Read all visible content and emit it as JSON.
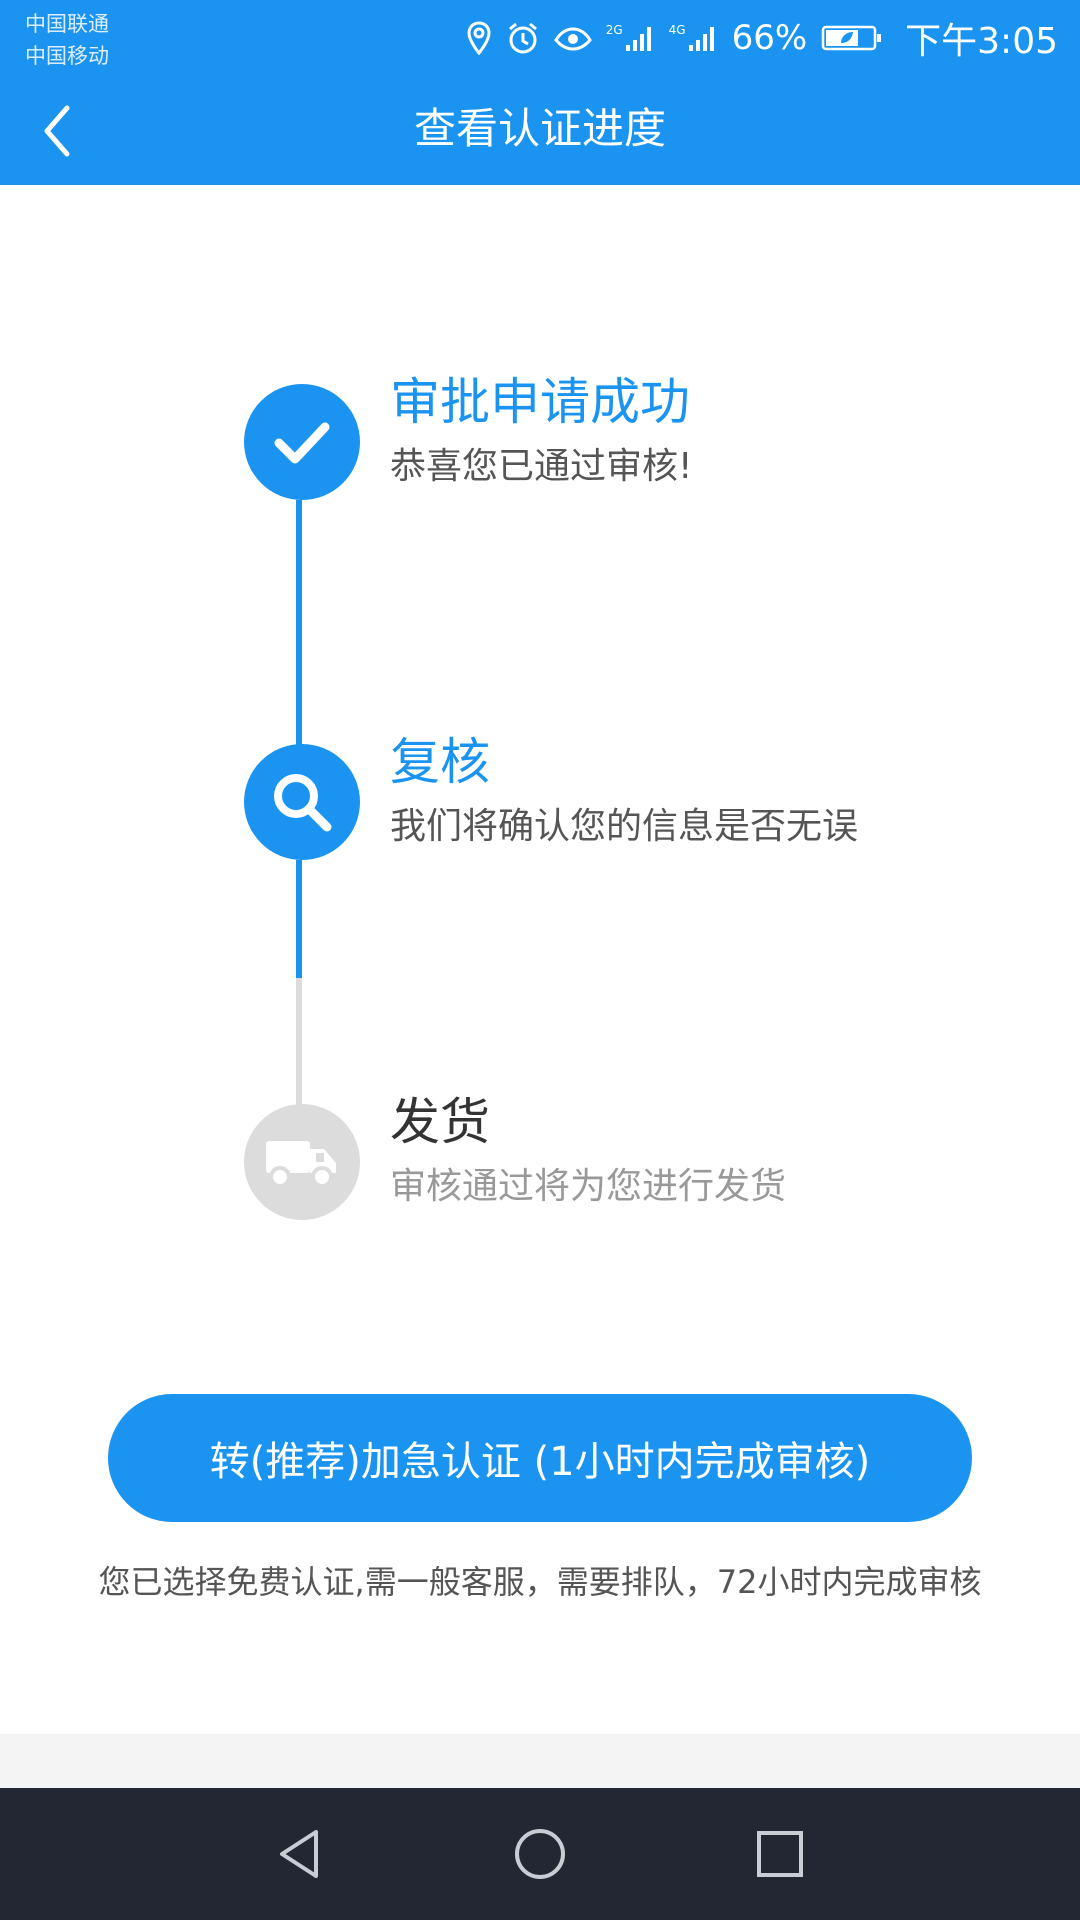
{
  "status_bar": {
    "carriers": [
      "中国联通",
      "中国移动"
    ],
    "network_1": "2G",
    "network_2": "4G",
    "battery": "66%",
    "time": "下午3:05",
    "icons": [
      "location-icon",
      "alarm-icon",
      "eye-icon",
      "signal-icon",
      "battery-icon"
    ]
  },
  "header": {
    "title": "查看认证进度",
    "back_icon": "chevron-left-icon"
  },
  "steps": [
    {
      "title": "审批申请成功",
      "desc": "恭喜您已通过审核!",
      "state": "completed",
      "icon": "check-icon"
    },
    {
      "title": "复核",
      "desc": "我们将确认您的信息是否无误",
      "state": "current",
      "icon": "search-icon"
    },
    {
      "title": "发货",
      "desc": "审核通过将为您进行发货",
      "state": "pending",
      "icon": "truck-icon"
    }
  ],
  "action": {
    "button_label": "转(推荐)加急认证 (1小时内完成审核)",
    "note": "您已选择免费认证,需一般客服，需要排队，72小时内完成审核"
  },
  "nav_bar": {
    "buttons": [
      "back-triangle-icon",
      "home-circle-icon",
      "recents-square-icon"
    ]
  },
  "colors": {
    "primary": "#1b94f1",
    "inactive": "#dcdcdc",
    "navbar": "#222733"
  }
}
